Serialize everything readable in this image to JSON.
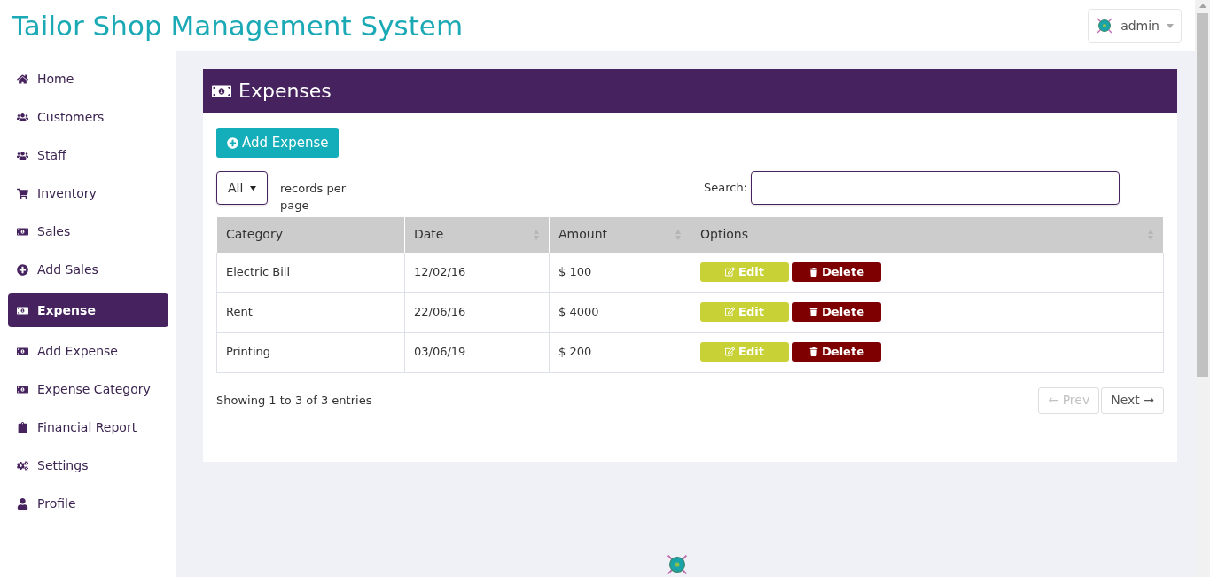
{
  "app_title": "Tailor Shop Management System",
  "user_menu": {
    "name": "admin"
  },
  "sidebar": {
    "items": [
      {
        "label": "Home",
        "selected": false
      },
      {
        "label": "Customers",
        "selected": false
      },
      {
        "label": "Staff",
        "selected": false
      },
      {
        "label": "Inventory",
        "selected": false
      },
      {
        "label": "Sales",
        "selected": false
      },
      {
        "label": "Add Sales",
        "selected": false
      },
      {
        "label": "Expense",
        "selected": true
      },
      {
        "label": "Add Expense",
        "selected": false
      },
      {
        "label": "Expense Category",
        "selected": false
      },
      {
        "label": "Financial Report",
        "selected": false
      },
      {
        "label": "Settings",
        "selected": false
      },
      {
        "label": "Profile",
        "selected": false
      }
    ]
  },
  "panel": {
    "title": "Expenses",
    "add_button": "Add Expense",
    "page_size": {
      "value": "All",
      "label": "records per page"
    },
    "search": {
      "label": "Search:"
    },
    "table": {
      "columns": [
        {
          "label": "Category",
          "sortable": false
        },
        {
          "label": "Date",
          "sortable": true
        },
        {
          "label": "Amount",
          "sortable": true
        },
        {
          "label": "Options",
          "sortable": true
        }
      ],
      "rows": [
        {
          "category": "Electric Bill",
          "date": "12/02/16",
          "amount": "$ 100",
          "edit_label": "Edit",
          "delete_label": "Delete"
        },
        {
          "category": "Rent",
          "date": "22/06/16",
          "amount": "$ 4000",
          "edit_label": "Edit",
          "delete_label": "Delete"
        },
        {
          "category": "Printing",
          "date": "03/06/19",
          "amount": "$ 200",
          "edit_label": "Edit",
          "delete_label": "Delete"
        }
      ]
    },
    "info": "Showing 1 to 3 of 3 entries",
    "pagination": [
      {
        "label": "← Prev",
        "disabled": true
      },
      {
        "label": "Next →",
        "disabled": false
      }
    ]
  }
}
